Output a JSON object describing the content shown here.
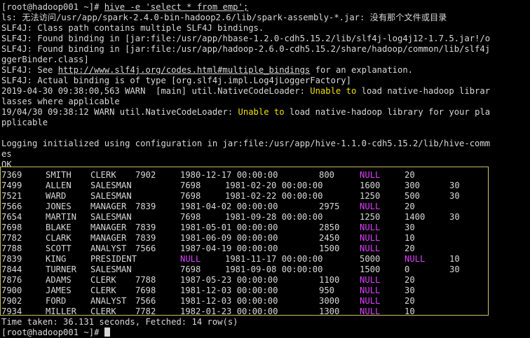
{
  "terminal": {
    "lines": [
      {
        "segs": [
          {
            "t": "[root@hadoop001 ~]# "
          },
          {
            "t": "hive -e 'select * from emp';",
            "u": true
          }
        ]
      },
      {
        "segs": [
          {
            "t": "ls: 无法访问/usr/app/spark-2.4.0-bin-hadoop2.6/lib/spark-assembly-*.jar: 没有那个文件或目录"
          }
        ]
      },
      {
        "segs": [
          {
            "t": "SLF4J: Class path contains multiple SLF4J bindings."
          }
        ]
      },
      {
        "segs": [
          {
            "t": "SLF4J: Found binding in [jar:file:/usr/app/hbase-1.2.0-cdh5.15.2/lib/slf4j-log4j12-1.7.5.jar!/o"
          }
        ]
      },
      {
        "segs": [
          {
            "t": "SLF4J: Found binding in [jar:file:/usr/app/hadoop-2.6.0-cdh5.15.2/share/hadoop/common/lib/slf4j"
          }
        ]
      },
      {
        "segs": [
          {
            "t": "ggerBinder.class]"
          }
        ]
      },
      {
        "segs": [
          {
            "t": "SLF4J: See "
          },
          {
            "t": "http://www.slf4j.org/codes.html#multiple_bindings",
            "u": true
          },
          {
            "t": " for an explanation."
          }
        ]
      },
      {
        "segs": [
          {
            "t": "SLF4J: Actual binding is of type [org.slf4j.impl.Log4jLoggerFactory]"
          }
        ]
      },
      {
        "segs": [
          {
            "t": "2019-04-30 09:38:00,563 WARN  [main] util.NativeCodeLoader: "
          },
          {
            "t": "Unable to",
            "y": true
          },
          {
            "t": " load native-hadoop librar"
          }
        ]
      },
      {
        "segs": [
          {
            "t": "lasses where applicable"
          }
        ]
      },
      {
        "segs": [
          {
            "t": "19/04/30 09:38:12 WARN util.NativeCodeLoader: "
          },
          {
            "t": "Unable to",
            "y": true
          },
          {
            "t": " load native-hadoop library for your pla"
          }
        ]
      },
      {
        "segs": [
          {
            "t": "pplicable"
          }
        ]
      },
      {
        "segs": [
          {
            "t": ""
          }
        ]
      },
      {
        "segs": [
          {
            "t": "Logging initialized using configuration in jar:file:/usr/app/hive-1.1.0-cdh5.15.2/lib/hive-comm"
          }
        ]
      },
      {
        "segs": [
          {
            "t": "es"
          }
        ]
      },
      {
        "segs": [
          {
            "t": "OK"
          }
        ]
      }
    ],
    "rows": [
      [
        "7369",
        "SMITH",
        "CLERK",
        "7902",
        "1980-12-17 00:00:00",
        "800",
        "NULL",
        "20"
      ],
      [
        "7499",
        "ALLEN",
        "SALESMAN",
        "7698",
        "1981-02-20 00:00:00",
        "1600",
        "300",
        "30"
      ],
      [
        "7521",
        "WARD",
        "SALESMAN",
        "7698",
        "1981-02-22 00:00:00",
        "1250",
        "500",
        "30"
      ],
      [
        "7566",
        "JONES",
        "MANAGER",
        "7839",
        "1981-04-02 00:00:00",
        "2975",
        "NULL",
        "20"
      ],
      [
        "7654",
        "MARTIN",
        "SALESMAN",
        "7698",
        "1981-09-28 00:00:00",
        "1250",
        "1400",
        "30"
      ],
      [
        "7698",
        "BLAKE",
        "MANAGER",
        "7839",
        "1981-05-01 00:00:00",
        "2850",
        "NULL",
        "30"
      ],
      [
        "7782",
        "CLARK",
        "MANAGER",
        "7839",
        "1981-06-09 00:00:00",
        "2450",
        "NULL",
        "10"
      ],
      [
        "7788",
        "SCOTT",
        "ANALYST",
        "7566",
        "1987-04-19 00:00:00",
        "1500",
        "NULL",
        "20"
      ],
      [
        "7839",
        "KING",
        "PRESIDENT",
        "NULL",
        "1981-11-17 00:00:00",
        "5000",
        "NULL",
        "10"
      ],
      [
        "7844",
        "TURNER",
        "SALESMAN",
        "7698",
        "1981-09-08 00:00:00",
        "1500",
        "0",
        "30"
      ],
      [
        "7876",
        "ADAMS",
        "CLERK",
        "7788",
        "1987-05-23 00:00:00",
        "1100",
        "NULL",
        "20"
      ],
      [
        "7900",
        "JAMES",
        "CLERK",
        "7698",
        "1981-12-03 00:00:00",
        "950",
        "NULL",
        "30"
      ],
      [
        "7902",
        "FORD",
        "ANALYST",
        "7566",
        "1981-12-03 00:00:00",
        "3000",
        "NULL",
        "20"
      ],
      [
        "7934",
        "MILLER",
        "CLERK",
        "7782",
        "1982-01-23 00:00:00",
        "1300",
        "NULL",
        "10"
      ]
    ],
    "footer": "Time taken: 36.131 seconds, Fetched: 14 row(s)",
    "prompt": "[root@hadoop001 ~]# ",
    "colors": {
      "background": "#000000",
      "text": "#d8d8d8",
      "warn": "#f0e000",
      "null": "#e040ff",
      "box": "#c8c060"
    }
  }
}
